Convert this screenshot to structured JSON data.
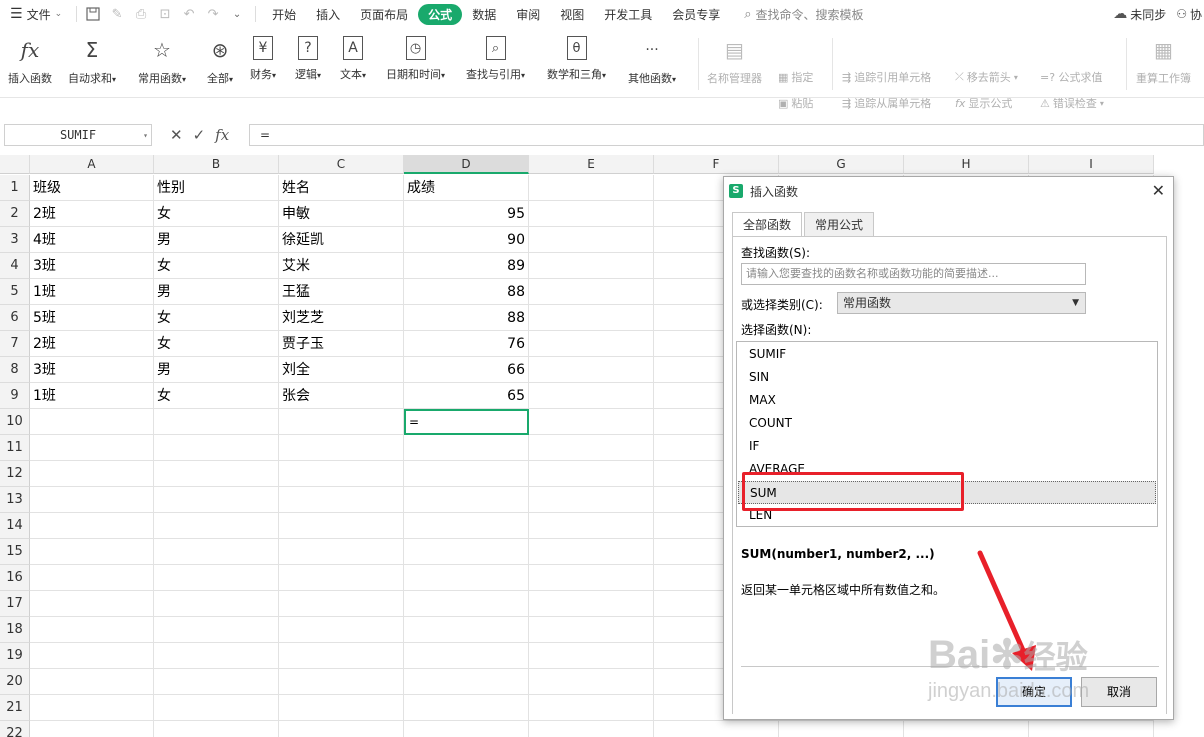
{
  "menubar": {
    "file_label": "文件",
    "tabs": [
      "开始",
      "插入",
      "页面布局",
      "公式",
      "数据",
      "审阅",
      "视图",
      "开发工具",
      "会员专享"
    ],
    "active_tab_index": 3,
    "search_label": "查找命令、搜索模板",
    "sync_label": "未同步",
    "collab_label": "协"
  },
  "ribbon": {
    "insert_function": "插入函数",
    "autosum": "自动求和",
    "common_functions": "常用函数",
    "all": "全部",
    "financial": "财务",
    "logical": "逻辑",
    "text": "文本",
    "datetime": "日期和时间",
    "lookup": "查找与引用",
    "math": "数学和三角",
    "other": "其他函数",
    "name_manager": "名称管理器",
    "specify": "指定",
    "paste": "粘贴",
    "trace_precedents": "追踪引用单元格",
    "trace_dependents": "追踪从属单元格",
    "remove_arrows": "移去箭头",
    "show_formulas": "显示公式",
    "evaluate_formula": "=? 公式求值",
    "error_check": "错误检查",
    "recalc": "重算工作簿"
  },
  "formula_bar": {
    "name_box": "SUMIF",
    "formula": "="
  },
  "grid": {
    "columns": [
      "A",
      "B",
      "C",
      "D",
      "E",
      "F",
      "G",
      "H",
      "I"
    ],
    "selected_column": "D",
    "rows": [
      "1",
      "2",
      "3",
      "4",
      "5",
      "6",
      "7",
      "8",
      "9",
      "10",
      "11",
      "12",
      "13",
      "14",
      "15",
      "16",
      "17",
      "18",
      "19",
      "20",
      "21",
      "22"
    ],
    "data": [
      [
        "班级",
        "性别",
        "姓名",
        "成绩"
      ],
      [
        "2班",
        "女",
        "申敏",
        "95"
      ],
      [
        "4班",
        "男",
        "徐延凯",
        "90"
      ],
      [
        "3班",
        "女",
        "艾米",
        "89"
      ],
      [
        "1班",
        "男",
        "王猛",
        "88"
      ],
      [
        "5班",
        "女",
        "刘芝芝",
        "88"
      ],
      [
        "2班",
        "女",
        "贾子玉",
        "76"
      ],
      [
        "3班",
        "男",
        "刘全",
        "66"
      ],
      [
        "1班",
        "女",
        "张会",
        "65"
      ]
    ],
    "active_cell_value": "="
  },
  "dialog": {
    "title": "插入函数",
    "tabs": [
      "全部函数",
      "常用公式"
    ],
    "search_label": "查找函数(S):",
    "search_placeholder": "请输入您要查找的函数名称或函数功能的简要描述...",
    "category_label": "或选择类别(C):",
    "category_value": "常用函数",
    "function_list_label": "选择函数(N):",
    "functions": [
      "SUMIF",
      "SIN",
      "MAX",
      "COUNT",
      "IF",
      "AVERAGE",
      "SUM",
      "LEN"
    ],
    "selected_function": "SUM",
    "signature": "SUM(number1, number2, ...)",
    "description": "返回某一单元格区域中所有数值之和。",
    "ok_label": "确定",
    "cancel_label": "取消"
  },
  "watermark": {
    "brand": "Bai",
    "brand2": "经验",
    "url": "jingyan.baidu.com"
  },
  "colors": {
    "accent": "#19a96c",
    "highlight": "#e8202a"
  }
}
